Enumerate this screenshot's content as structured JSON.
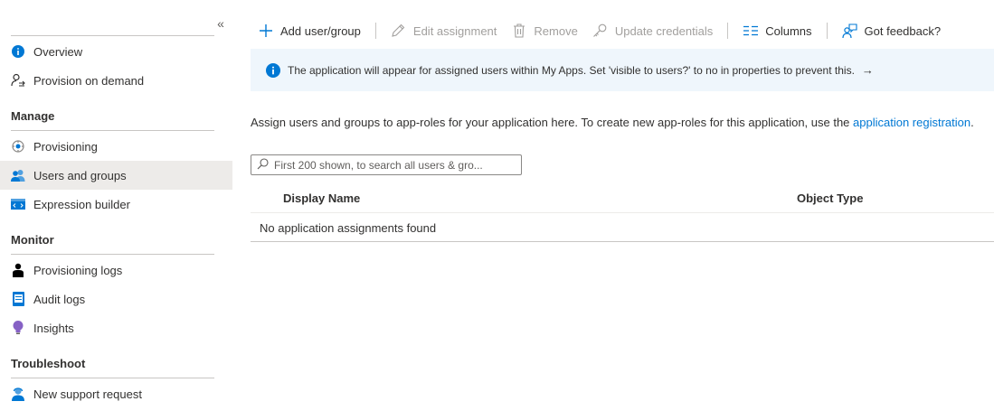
{
  "sidebar": {
    "collapse_glyph": "«",
    "items": [
      {
        "label": "Overview",
        "icon": "info-circle-icon"
      },
      {
        "label": "Provision on demand",
        "icon": "person-sync-icon"
      }
    ],
    "sections": [
      {
        "title": "Manage",
        "items": [
          {
            "label": "Provisioning",
            "icon": "provisioning-gear-icon"
          },
          {
            "label": "Users and groups",
            "icon": "users-icon",
            "selected": true
          },
          {
            "label": "Expression builder",
            "icon": "code-window-icon"
          }
        ]
      },
      {
        "title": "Monitor",
        "items": [
          {
            "label": "Provisioning logs",
            "icon": "person-log-icon"
          },
          {
            "label": "Audit logs",
            "icon": "audit-log-icon"
          },
          {
            "label": "Insights",
            "icon": "lightbulb-icon"
          }
        ]
      },
      {
        "title": "Troubleshoot",
        "items": [
          {
            "label": "New support request",
            "icon": "support-person-icon"
          }
        ]
      }
    ]
  },
  "toolbar": {
    "add_label": "Add user/group",
    "edit_label": "Edit assignment",
    "remove_label": "Remove",
    "update_label": "Update credentials",
    "columns_label": "Columns",
    "feedback_label": "Got feedback?"
  },
  "banner": {
    "text": "The application will appear for assigned users within My Apps. Set 'visible to users?' to no in properties to prevent this.",
    "arrow": "→"
  },
  "description": {
    "text": "Assign users and groups to app-roles for your application here. To create new app-roles for this application, use the ",
    "link": "application registration",
    "suffix": "."
  },
  "search": {
    "placeholder": "First 200 shown, to search all users & gro..."
  },
  "table": {
    "headers": [
      "Display Name",
      "Object Type"
    ],
    "empty_text": "No application assignments found"
  },
  "colors": {
    "accent": "#0078d4",
    "banner_bg": "#eff6fc",
    "selected_bg": "#edebe9"
  }
}
